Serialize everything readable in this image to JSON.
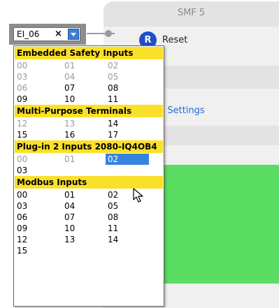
{
  "function_block": {
    "title": "SMF 5",
    "reset_icon_letter": "R",
    "reset_label": "Reset",
    "settings_link_partial": "ed Settings",
    "accent_color": "#5bdc63"
  },
  "input_selector": {
    "value": "EI_06",
    "clear_glyph": "×",
    "dropdown_icon": "chevron-down-icon"
  },
  "dropdown": {
    "selected_item": "02",
    "groups": [
      {
        "title": "Embedded Safety Inputs",
        "items": [
          {
            "label": "00",
            "enabled": false
          },
          {
            "label": "01",
            "enabled": false
          },
          {
            "label": "02",
            "enabled": false
          },
          {
            "label": "03",
            "enabled": false
          },
          {
            "label": "04",
            "enabled": false
          },
          {
            "label": "05",
            "enabled": false
          },
          {
            "label": "06",
            "enabled": false
          },
          {
            "label": "07",
            "enabled": true
          },
          {
            "label": "08",
            "enabled": true
          },
          {
            "label": "09",
            "enabled": true
          },
          {
            "label": "10",
            "enabled": true
          },
          {
            "label": "11",
            "enabled": true
          }
        ]
      },
      {
        "title": "Multi-Purpose Terminals",
        "items": [
          {
            "label": "12",
            "enabled": false
          },
          {
            "label": "13",
            "enabled": false
          },
          {
            "label": "14",
            "enabled": true
          },
          {
            "label": "15",
            "enabled": true
          },
          {
            "label": "16",
            "enabled": true
          },
          {
            "label": "17",
            "enabled": true
          }
        ]
      },
      {
        "title": "Plug-in 2 Inputs 2080-IQ4OB4",
        "items": [
          {
            "label": "00",
            "enabled": false
          },
          {
            "label": "01",
            "enabled": false
          },
          {
            "label": "02",
            "enabled": true,
            "selected": true
          },
          {
            "label": "03",
            "enabled": true
          }
        ]
      },
      {
        "title": "Modbus Inputs",
        "items": [
          {
            "label": "00",
            "enabled": true
          },
          {
            "label": "01",
            "enabled": true
          },
          {
            "label": "02",
            "enabled": true
          },
          {
            "label": "03",
            "enabled": true
          },
          {
            "label": "04",
            "enabled": true
          },
          {
            "label": "05",
            "enabled": true
          },
          {
            "label": "06",
            "enabled": true
          },
          {
            "label": "07",
            "enabled": true
          },
          {
            "label": "08",
            "enabled": true
          },
          {
            "label": "09",
            "enabled": true
          },
          {
            "label": "10",
            "enabled": true
          },
          {
            "label": "11",
            "enabled": true
          },
          {
            "label": "12",
            "enabled": true
          },
          {
            "label": "13",
            "enabled": true
          },
          {
            "label": "14",
            "enabled": true
          },
          {
            "label": "15",
            "enabled": true
          }
        ]
      }
    ]
  },
  "colors": {
    "group_header_bg": "#fbe02a",
    "selected_bg": "#3584e0",
    "disabled_text": "#9a9a9a",
    "link": "#1b6fd6"
  }
}
